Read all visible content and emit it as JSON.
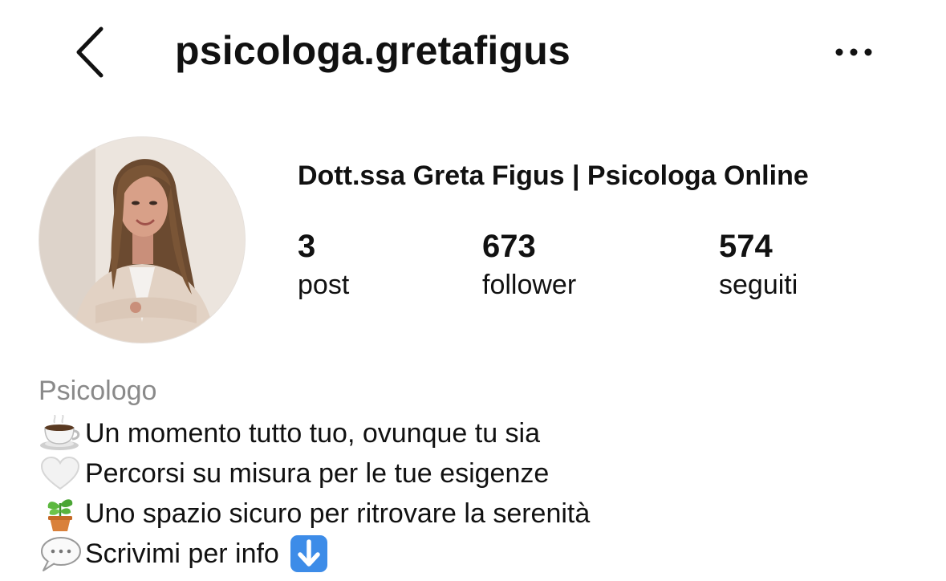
{
  "header": {
    "back_icon": "chevron-left-icon",
    "username": "psicologa.gretafigus",
    "more_icon": "more-horizontal-icon"
  },
  "profile": {
    "full_name": "Dott.ssa Greta Figus | Psicologa Online",
    "avatar": "profile-photo"
  },
  "stats": {
    "posts": {
      "count": "3",
      "label": "post"
    },
    "followers": {
      "count": "673",
      "label": "follower"
    },
    "following": {
      "count": "574",
      "label": "seguiti"
    }
  },
  "bio": {
    "category": "Psicologo",
    "lines": [
      {
        "icon": "hot-beverage-icon",
        "text": "Un momento tutto tuo, ovunque tu sia"
      },
      {
        "icon": "white-heart-icon",
        "text": "Percorsi su misura per le tue esigenze"
      },
      {
        "icon": "potted-plant-icon",
        "text": "Uno spazio sicuro per ritrovare la serenità"
      },
      {
        "icon": "speech-balloon-icon",
        "text": "Scrivimi per info",
        "trailing_icon": "down-arrow-icon"
      }
    ]
  },
  "colors": {
    "text": "#111111",
    "category_gray": "#8a8a8a",
    "arrow_blue": "#3d8ce8",
    "background": "#ffffff"
  }
}
